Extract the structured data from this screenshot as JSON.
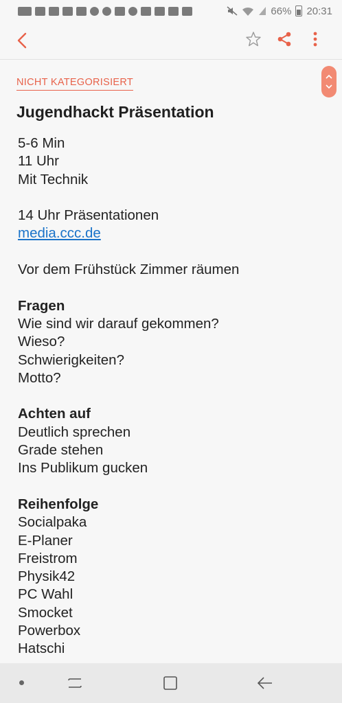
{
  "status_bar": {
    "battery_percent": "66%",
    "time": "20:31"
  },
  "toolbar": {
    "back_icon": "back-arrow-icon",
    "favorite_icon": "star-outline-icon",
    "share_icon": "share-icon",
    "more_icon": "more-vertical-icon",
    "accent_color": "#e8624a"
  },
  "note": {
    "category": "NICHT KATEGORISIERT",
    "title": "Jugendhackt Präsentation",
    "lines": [
      {
        "text": "5-6 Min",
        "style": "normal"
      },
      {
        "text": "11 Uhr",
        "style": "normal"
      },
      {
        "text": "Mit Technik",
        "style": "normal"
      },
      {
        "text": "",
        "style": "normal"
      },
      {
        "text": "14 Uhr Präsentationen",
        "style": "normal"
      },
      {
        "text": "media.ccc.de",
        "style": "link"
      },
      {
        "text": "",
        "style": "normal"
      },
      {
        "text": "Vor dem Frühstück Zimmer räumen",
        "style": "normal"
      },
      {
        "text": "",
        "style": "normal"
      },
      {
        "text": "Fragen",
        "style": "bold"
      },
      {
        "text": "Wie sind wir darauf gekommen?",
        "style": "normal"
      },
      {
        "text": "Wieso?",
        "style": "normal"
      },
      {
        "text": "Schwierigkeiten?",
        "style": "normal"
      },
      {
        "text": "Motto?",
        "style": "normal"
      },
      {
        "text": "",
        "style": "normal"
      },
      {
        "text": "Achten auf",
        "style": "bold"
      },
      {
        "text": "Deutlich sprechen",
        "style": "normal"
      },
      {
        "text": "Grade stehen",
        "style": "normal"
      },
      {
        "text": "Ins Publikum gucken",
        "style": "normal"
      },
      {
        "text": "",
        "style": "normal"
      },
      {
        "text": "Reihenfolge",
        "style": "bold"
      },
      {
        "text": "Socialpaka",
        "style": "normal"
      },
      {
        "text": "E-Planer",
        "style": "normal"
      },
      {
        "text": "Freistrom",
        "style": "normal"
      },
      {
        "text": "Physik42",
        "style": "normal"
      },
      {
        "text": "PC Wahl",
        "style": "normal"
      },
      {
        "text": "Smocket",
        "style": "normal"
      },
      {
        "text": "Powerbox",
        "style": "normal"
      },
      {
        "text": "Hatschi",
        "style": "normal"
      }
    ]
  },
  "nav_bar": {
    "icons": [
      "nav-dot-icon",
      "recent-apps-icon",
      "home-icon",
      "back-icon"
    ]
  }
}
